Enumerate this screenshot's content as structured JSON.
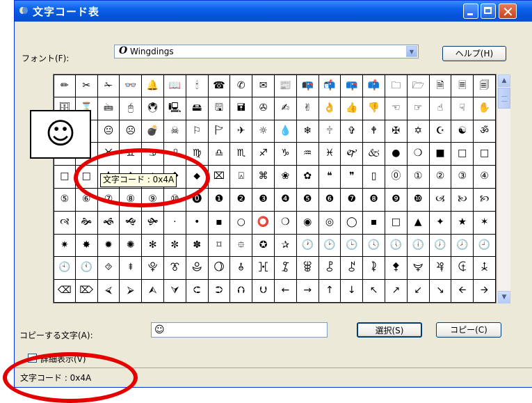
{
  "window": {
    "title": "文字コード表"
  },
  "font": {
    "label": "フォント(F):",
    "selected": "Wingdings"
  },
  "buttons": {
    "help": "ヘルプ(H)",
    "select": "選択(S)",
    "copy": "コピー(C)"
  },
  "copy_field": {
    "label": "コピーする文字(A):",
    "value": "☺"
  },
  "detail_view": {
    "label": "詳細表示(V)"
  },
  "zoom_char": "☺",
  "tooltip": "文字コード : 0x4A",
  "status": "文字コード : 0x4A",
  "annotation_color": "#e50000",
  "grid": [
    [
      "✏",
      "✂",
      "✁",
      "👓",
      "🔔",
      "📖",
      "🕯",
      "☎",
      "✆",
      "✉",
      "📰",
      "📭",
      "📬",
      "📪",
      "📫",
      "🗀",
      "🗁",
      "🗎",
      "🗏",
      "🗐"
    ],
    [
      "🗄",
      "⌛",
      "🖮",
      "🖰",
      "🖲",
      "🖳",
      "🖴",
      "🖫",
      "🖬",
      "✇",
      "✍",
      "✌",
      "👌",
      "👍",
      "👎",
      "☜",
      "☞",
      "☝",
      "☟",
      "✋"
    ],
    [
      "☺",
      "☺",
      "😐",
      "☹",
      "💣",
      "☠",
      "⚐",
      "🏱",
      "✈",
      "☼",
      "💧",
      "❄",
      "🕆",
      "✞",
      "🕈",
      "✠",
      "✡",
      "☪",
      "☯",
      "ॐ"
    ],
    [
      "☸",
      "♈",
      "♉",
      "♊",
      "♋",
      "♌",
      "♍",
      "♎",
      "♏",
      "♐",
      "♑",
      "♒",
      "♓",
      "🙰",
      "🙵",
      "●",
      "❍",
      "■",
      "□",
      "□"
    ],
    [
      "□",
      "□",
      "⧫",
      "♦",
      "◆",
      "❖",
      "⬥",
      "⌧",
      "⍓",
      "⌘",
      "❀",
      "✿",
      "❝",
      "❞",
      "▯",
      "⓪",
      "①",
      "②",
      "③",
      "④"
    ],
    [
      "⑤",
      "⑥",
      "⑦",
      "⑧",
      "⑨",
      "⑩",
      "⓿",
      "❶",
      "❷",
      "❸",
      "❹",
      "❺",
      "❻",
      "❼",
      "❽",
      "❾",
      "❿",
      "🙢",
      "🙠",
      "🙡"
    ],
    [
      "🙣",
      "🙞",
      "🙜",
      "🙝",
      "🙟",
      "·",
      "•",
      "▪",
      "○",
      "⭕",
      "❍",
      "◉",
      "◎",
      "◯",
      "▪",
      "□",
      "▲",
      "✦",
      "★",
      "✶"
    ],
    [
      "✷",
      "✸",
      "✹",
      "✺",
      "✻",
      "✼",
      "✽",
      "⌑",
      "⯐",
      "✪",
      "✰",
      "🕐",
      "🕑",
      "🕒",
      "🕓",
      "🕔",
      "🕕",
      "🕖",
      "🕗",
      "🕘"
    ],
    [
      "🕙",
      "🕚",
      "⯑",
      "⯒",
      "⯓",
      "⯔",
      "⯕",
      "⯖",
      "⯗",
      "⯘",
      "⯙",
      "⯚",
      "⯛",
      "⯜",
      "⯝",
      "⯞",
      "⯟",
      "⯠",
      "⯡",
      "⯢"
    ],
    [
      "⌫",
      "⌦",
      "⮘",
      "⮚",
      "⮙",
      "⮛",
      "⮈",
      "⮊",
      "⮉",
      "⮋",
      "←",
      "→",
      "↑",
      "↓",
      "↖",
      "↗",
      "↙",
      "↘",
      "🡨",
      "🡪"
    ]
  ]
}
